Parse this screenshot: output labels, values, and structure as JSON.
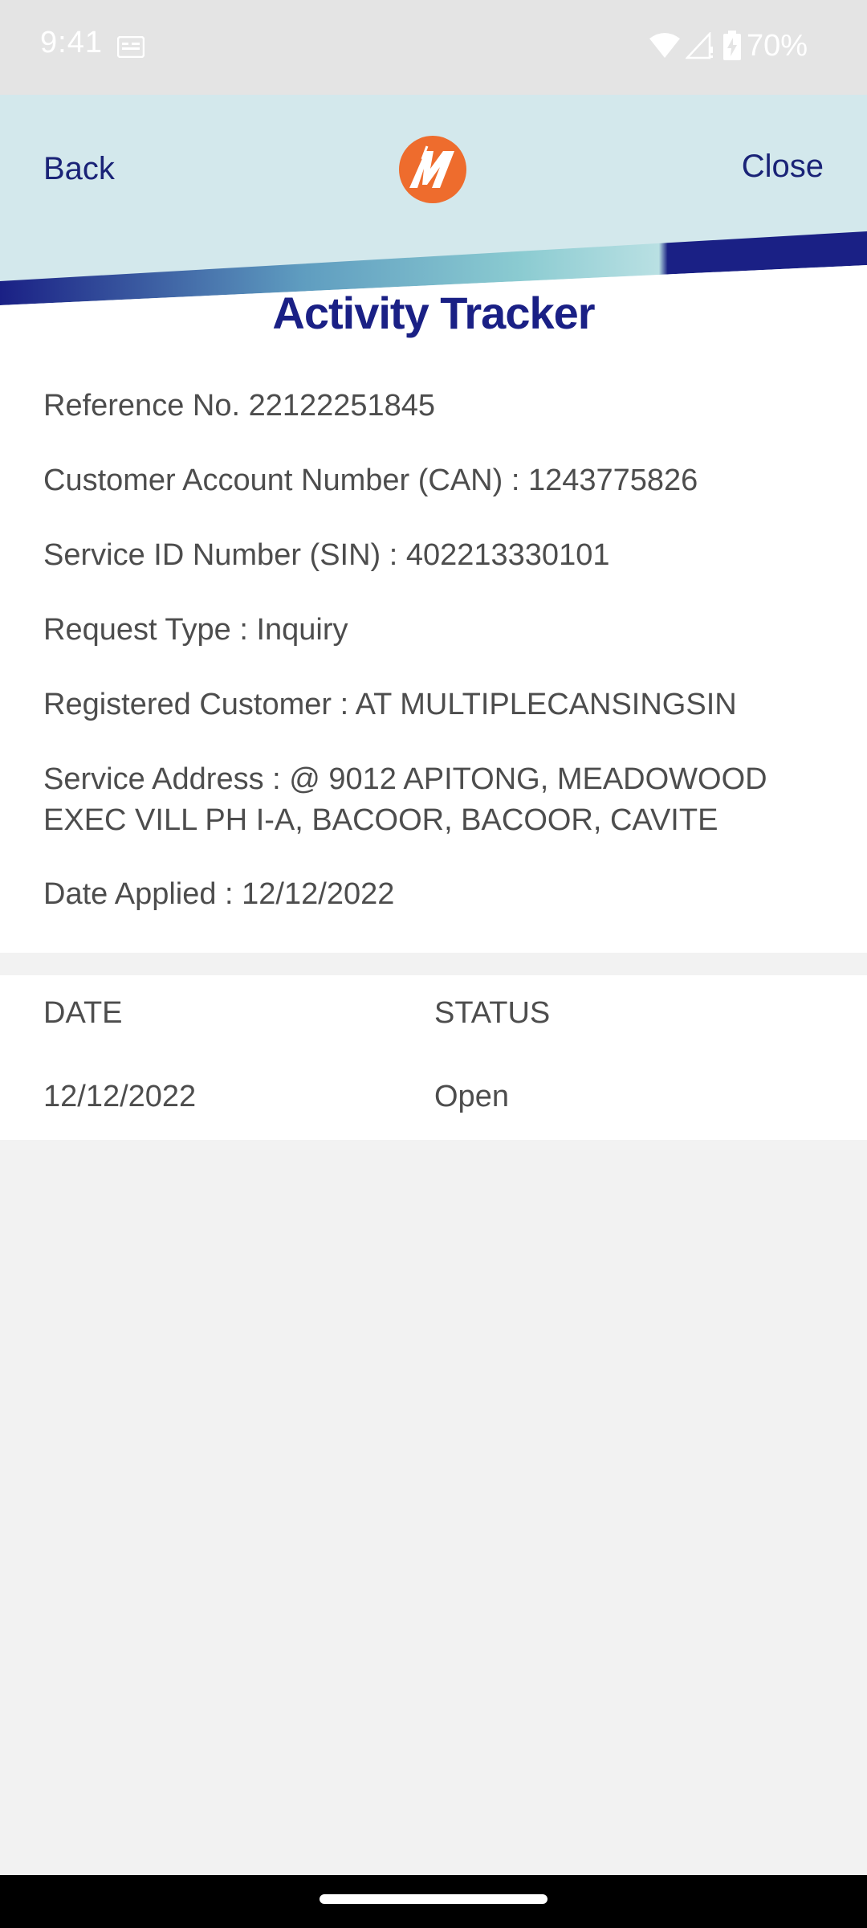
{
  "status_bar": {
    "time": "9:41",
    "battery": "70%"
  },
  "header": {
    "back_label": "Back",
    "close_label": "Close",
    "logo_icon": "meralco-logo-icon",
    "colors": {
      "header_bg": "#d3e8ec",
      "navy": "#1a2085",
      "teal": "#7cc6cf",
      "logo_orange": "#ee6c2d"
    }
  },
  "details": {
    "title": "Activity Tracker",
    "reference": "Reference No. 22122251845",
    "can": "Customer Account Number (CAN) : 1243775826",
    "sin": "Service ID Number (SIN) : 402213330101",
    "request_type": "Request Type : Inquiry",
    "registered_customer": "Registered Customer : AT MULTIPLECANSINGSIN",
    "service_address_line1": "Service Address : @ 9012 APITONG, MEADOWOOD",
    "service_address_line2": "EXEC VILL PH I-A, BACOOR, BACOOR, CAVITE",
    "date_applied": "Date Applied : 12/12/2022"
  },
  "activity": {
    "columns": [
      "DATE",
      "STATUS"
    ],
    "rows": [
      {
        "date": "12/12/2022",
        "status": "Open"
      }
    ]
  }
}
